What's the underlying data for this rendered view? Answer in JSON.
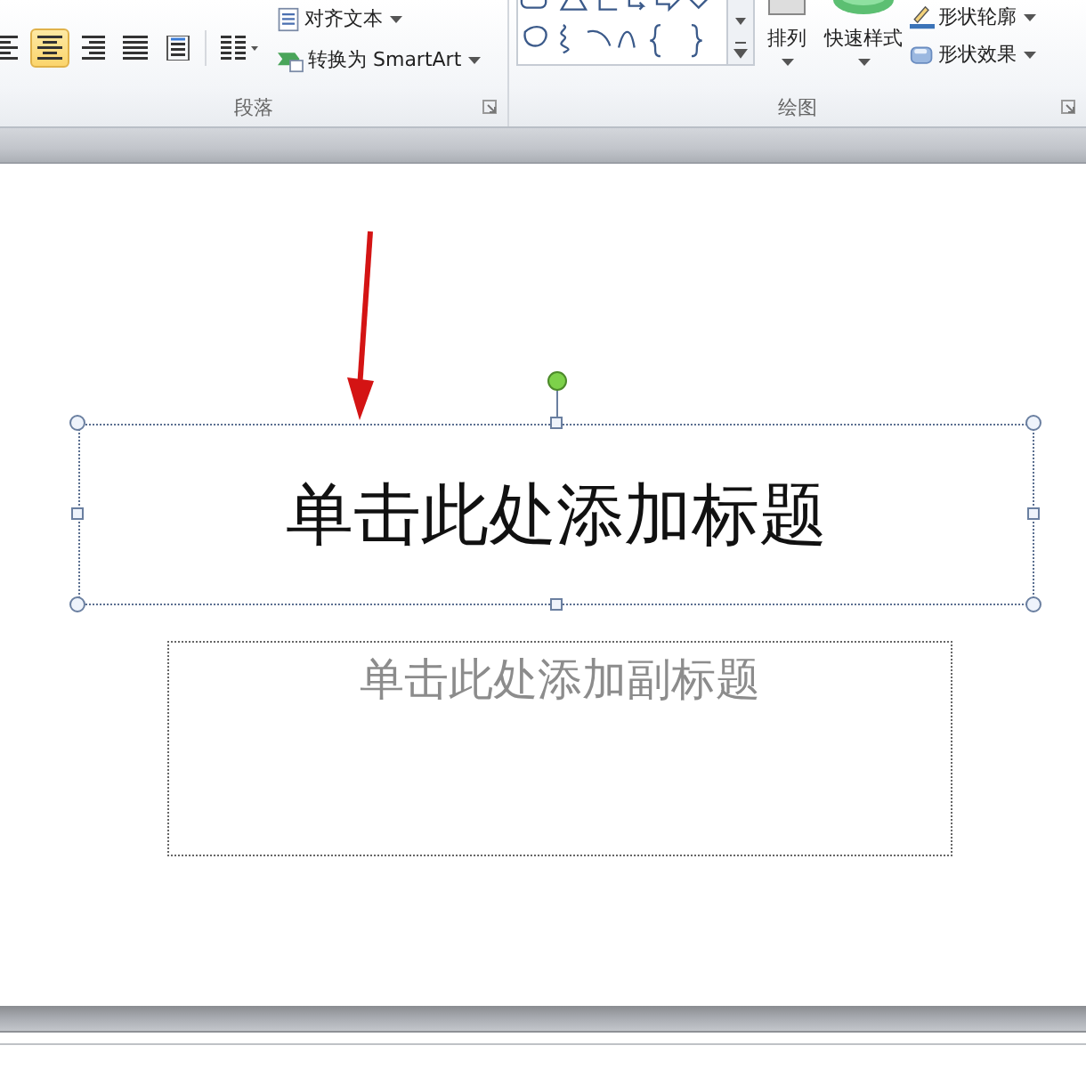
{
  "ribbon": {
    "paragraph": {
      "align_buttons": [
        {
          "kind": "left",
          "selected": false
        },
        {
          "kind": "center",
          "selected": true
        },
        {
          "kind": "right",
          "selected": false
        },
        {
          "kind": "justify",
          "selected": false
        },
        {
          "kind": "distributed",
          "selected": false
        }
      ],
      "commands": [
        {
          "label": "对齐文本",
          "kind": "align-text"
        },
        {
          "label": "转换为 SmartArt",
          "kind": "smartart"
        }
      ],
      "label": "段落"
    },
    "drawing": {
      "big_buttons": [
        {
          "label": "排列",
          "kind": "arrange"
        },
        {
          "label": "快速样式",
          "kind": "quick-styles"
        }
      ],
      "commands": [
        {
          "label": "形状轮廓",
          "kind": "outline"
        },
        {
          "label": "形状效果",
          "kind": "effects"
        }
      ],
      "label": "绘图"
    }
  },
  "slide": {
    "title_placeholder": {
      "text": "单击此处添加标题",
      "selected": true
    },
    "subtitle_placeholder": {
      "text": "单击此处添加副标题"
    }
  }
}
